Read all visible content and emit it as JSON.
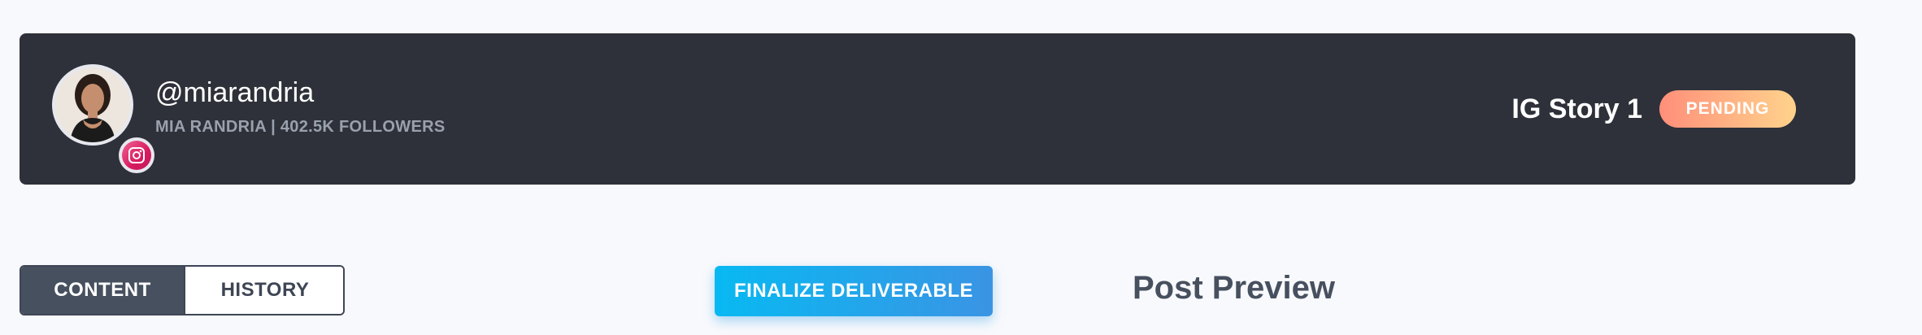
{
  "creator": {
    "handle": "@miarandria",
    "subline": "MIA RANDRIA | 402.5K FOLLOWERS",
    "platform_icon": "instagram-icon"
  },
  "deliverable": {
    "title": "IG Story 1",
    "status": "PENDING",
    "status_colors": [
      "#ff8f7a",
      "#ffd38c"
    ]
  },
  "tabs": [
    {
      "label": "CONTENT",
      "active": true
    },
    {
      "label": "HISTORY",
      "active": false
    }
  ],
  "actions": {
    "finalize_label": "FINALIZE DELIVERABLE"
  },
  "preview": {
    "title": "Post Preview"
  },
  "colors": {
    "header_bg": "#2e3139",
    "accent": "#08b9f2",
    "tab_active": "#47505f"
  }
}
